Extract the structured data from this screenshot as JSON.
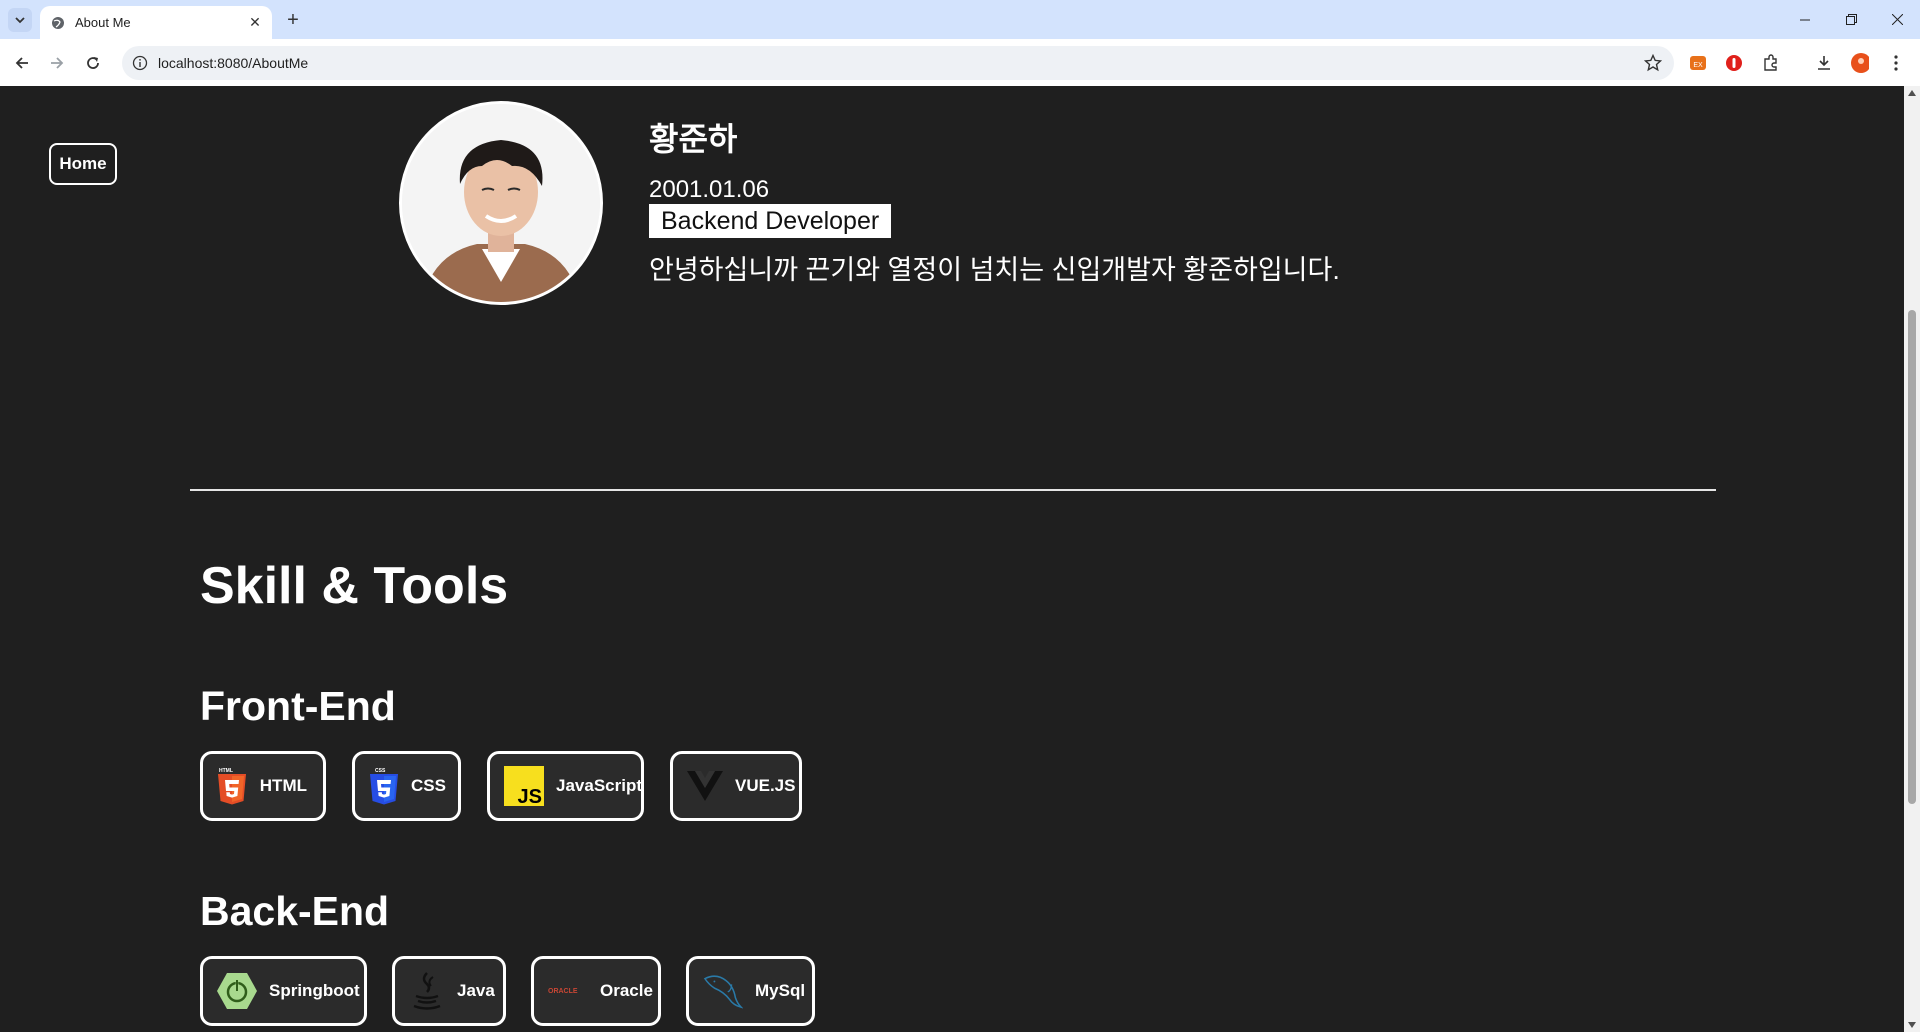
{
  "browser": {
    "tab_title": "About Me",
    "url": "localhost:8080/AboutMe"
  },
  "nav": {
    "home_label": "Home"
  },
  "profile": {
    "name": "황준하",
    "birth": "2001.01.06",
    "role": "Backend Developer",
    "intro": "안녕하십니까 끈기와 열정이 넘치는 신입개발자 황준하입니다."
  },
  "skills": {
    "title": "Skill & Tools",
    "frontend": {
      "title": "Front-End",
      "items": [
        {
          "label": "HTML",
          "icon": "html5-icon"
        },
        {
          "label": "CSS",
          "icon": "css3-icon"
        },
        {
          "label": "JavaScript",
          "icon": "javascript-icon"
        },
        {
          "label": "VUE.JS",
          "icon": "vue-icon"
        }
      ]
    },
    "backend": {
      "title": "Back-End",
      "items": [
        {
          "label": "Springboot",
          "icon": "spring-icon"
        },
        {
          "label": "Java",
          "icon": "java-icon"
        },
        {
          "label": "Oracle",
          "icon": "oracle-icon"
        },
        {
          "label": "MySql",
          "icon": "mysql-icon"
        }
      ]
    }
  },
  "colors": {
    "page_bg": "#1f1f1f",
    "tabbar_bg": "#d3e3fd",
    "html_orange": "#e44d26",
    "css_blue": "#264de4",
    "js_yellow": "#f7df1e",
    "spring_green": "#6db33f",
    "oracle_red": "#c74634",
    "mysql_blue": "#00758f"
  }
}
